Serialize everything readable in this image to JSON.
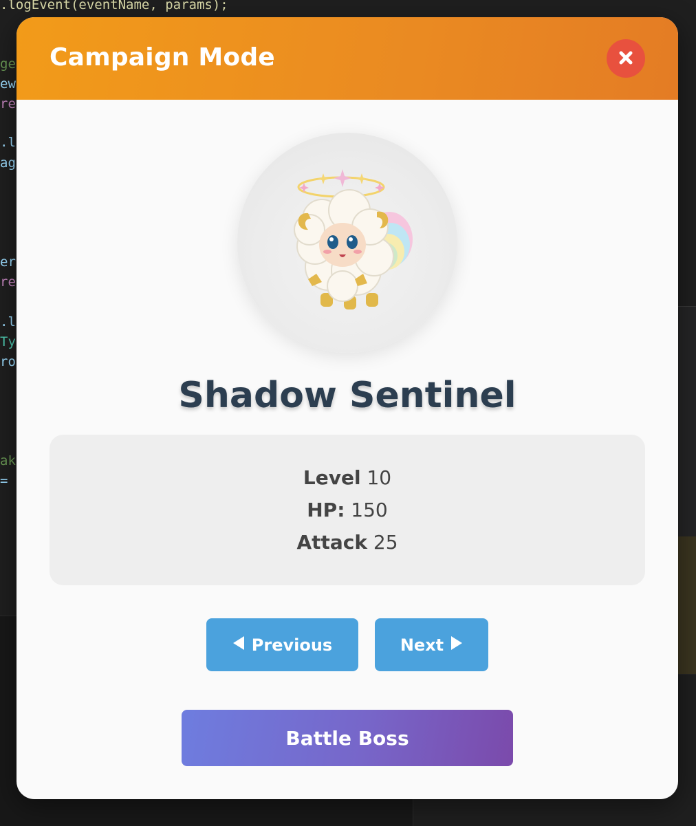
{
  "background": {
    "code_top_line": ".logEvent(eventName, params);",
    "description_hidden": ""
  },
  "modal": {
    "title": "Campaign Mode",
    "close_icon": "close-x-icon",
    "enemy": {
      "avatar": "fluffy-rainbow-sheep-sprite",
      "name": "Shadow Sentinel"
    },
    "stats": {
      "level_label": "Level",
      "level_value": "10",
      "hp_label": "HP:",
      "hp_value": "150",
      "attack_label": "Attack",
      "attack_value": "25"
    },
    "navigation": {
      "previous_label": "Previous",
      "previous_icon": "triangle-left-icon",
      "next_label": "Next",
      "next_icon": "triangle-right-icon"
    },
    "battle_label": "Battle Boss"
  },
  "colors": {
    "header_start": "#f29b19",
    "header_end": "#e47c24",
    "close_button": "#e8513e",
    "nav_button": "#4ba2dd",
    "battle_start": "#6e7ddf",
    "battle_end": "#7b4aab",
    "name_text": "#2c3e50"
  }
}
